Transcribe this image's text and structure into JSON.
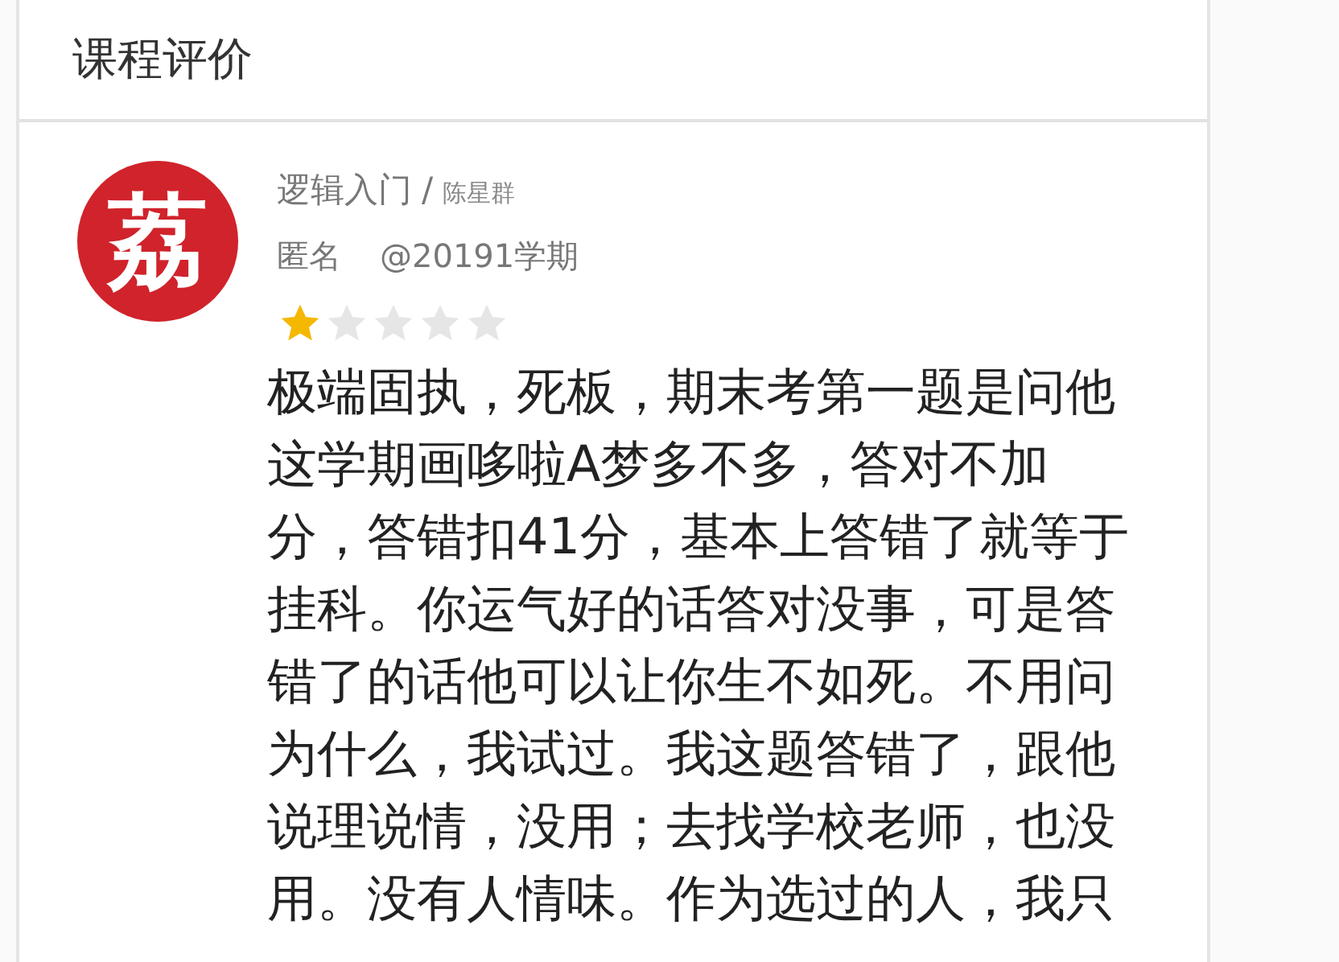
{
  "header": {
    "title": "课程评价"
  },
  "review": {
    "avatar": "荔",
    "course": "逻辑入门",
    "separator": "/",
    "teacher": "陈星群",
    "author": "匿名",
    "term": "@20191学期",
    "stars": 1,
    "lines": [
      "极端固执，死板，期末考第一题是问他",
      "这学期画哆啦A梦多不多，答对不加",
      "分，答错扣41分，基本上答错了就等于",
      "挂科。你运气好的话答对没事，可是答",
      "错了的话他可以让你生不如死。不用问",
      "为什么，我试过。我这题答错了，跟他",
      "说理说情，没用；去找学校老师，也没",
      "用。没有人情味。作为选过的人，我只"
    ]
  }
}
